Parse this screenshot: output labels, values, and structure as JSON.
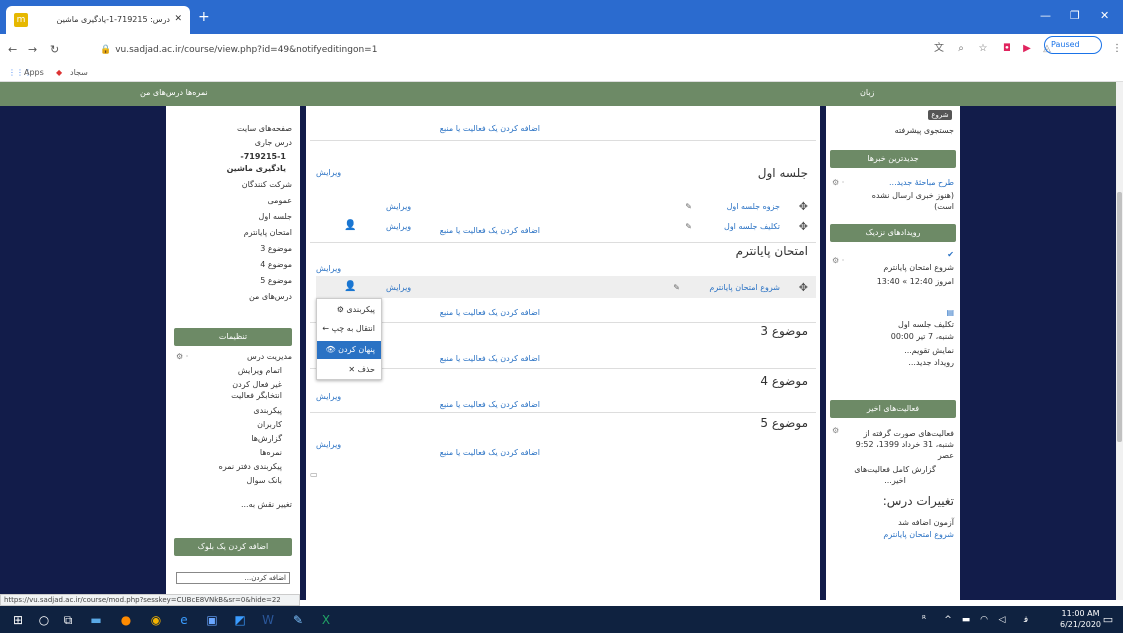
{
  "browser": {
    "tab_title": "درس: 719215-1-یادگیری ماشین",
    "url": "vu.sadjad.ac.ir/course/view.php?id=49&notifyeditingon=1",
    "paused_label": "Paused",
    "bookmarks": {
      "apps": "Apps",
      "item": "سجاد"
    }
  },
  "topnav": {
    "left_links": "نمره‌ها    درس‌های من",
    "language": "زبان"
  },
  "left_nav": {
    "items": [
      "صفحه‌های سایت",
      "درس جاری",
      "719215-1-",
      "یادگیری ماشین",
      "شرکت کنندگان",
      "عمومی",
      "جلسه اول",
      "امتحان پایانترم",
      "موضوع 3",
      "موضوع 4",
      "موضوع 5",
      "درس‌های من"
    ]
  },
  "settings": {
    "title": "تنظیمات",
    "items": [
      "مدیریت درس",
      "اتمام ویرایش",
      "غیر فعال کردن",
      "انتخابگر فعالیت",
      "پیکربندی",
      "کاربران",
      "گزارش‌ها",
      "نمره‌ها",
      "پیکربندی دفتر نمره",
      "بانک سوال",
      "تغییر نقش به..."
    ]
  },
  "add_block": {
    "title": "اضافه کردن یک بلوک",
    "select_value": "اضافه کردن..."
  },
  "main": {
    "add_activity": "اضافه کردن یک فعالیت یا منبع",
    "edit": "ویرایش",
    "sections": [
      {
        "title": "جلسه اول",
        "activities": [
          "جزوه جلسه اول",
          "تکلیف جلسه اول"
        ]
      },
      {
        "title": "امتحان پایانترم",
        "activities": [
          "شروع امتحان پایانترم"
        ]
      },
      {
        "title": "موضوع 3",
        "activities": []
      },
      {
        "title": "موضوع 4",
        "activities": []
      },
      {
        "title": "موضوع 5",
        "activities": []
      }
    ]
  },
  "context_menu": {
    "items": [
      "پیکربندی",
      "انتقال به چپ",
      "پنهان کردن",
      "حذف"
    ]
  },
  "right": {
    "search_label": "جستجوی پیشرفته",
    "search_button": "شروع",
    "news": {
      "title": "جدیدترین خبرها",
      "line1": "طرح مباحثهٔ جدید...",
      "line2": "(هنوز خبری ارسال نشده است)"
    },
    "events": {
      "title": "رویدادهای نزدیک",
      "e1_title": "شروع امتحان پایانترم",
      "e1_time": "امروز 12:40 » 13:40",
      "e2_title": "تکلیف جلسه اول",
      "e2_time": "شنبه، 7 تیر 00:00",
      "calendar": "نمایش تقویم...",
      "new_event": "رویداد جدید..."
    },
    "activity": {
      "title": "فعالیت‌های اخیر",
      "since": "فعالیت‌های صورت گرفته از شنبه، 31 خرداد 1399، 9:52 عصر",
      "report": "گزارش کامل فعالیت‌های اخیر...",
      "changes": "تغییرات درس:",
      "change1": "آزمون اضافه شد",
      "change2": "شروع امتحان پایانترم"
    }
  },
  "status_url": "https://vu.sadjad.ac.ir/course/mod.php?sesskey=CUBcE8VNkB&sr=0&hide=22",
  "taskbar": {
    "time": "11:00 AM",
    "date": "6/21/2020"
  }
}
